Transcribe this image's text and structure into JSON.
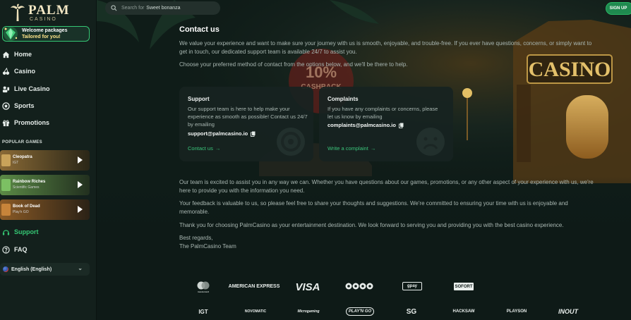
{
  "brand": {
    "name": "PALM",
    "sub": "CASINO"
  },
  "topbar": {
    "search_placeholder": "Search for",
    "search_query": "Sweet bonanza",
    "signup_label": "SIGN UP"
  },
  "welcome": {
    "line1": "Welcome packages",
    "line2": "Tailored for you!"
  },
  "nav": [
    {
      "label": "Home",
      "icon": "home-icon"
    },
    {
      "label": "Casino",
      "icon": "cherries-icon"
    },
    {
      "label": "Live Casino",
      "icon": "live-dealer-icon"
    },
    {
      "label": "Sports",
      "icon": "ball-icon"
    },
    {
      "label": "Promotions",
      "icon": "gift-icon"
    }
  ],
  "popular_games": {
    "title": "POPULAR GAMES",
    "items": [
      {
        "name": "Cleopatra",
        "provider": "IGT",
        "color": "#6f5a33"
      },
      {
        "name": "Rainbow Riches",
        "provider": "Scientific Games",
        "color": "#4d6d3a"
      },
      {
        "name": "Book of Dead",
        "provider": "Play'n GO",
        "color": "#6b4a24"
      }
    ]
  },
  "footer_nav": [
    {
      "label": "Support",
      "icon": "headset-icon",
      "active": true
    },
    {
      "label": "FAQ",
      "icon": "question-icon",
      "active": false
    }
  ],
  "language": {
    "label": "English (English)"
  },
  "contact": {
    "title": "Contact us",
    "intro1": "We value your experience and want to make sure your journey with us is smooth, enjoyable, and trouble-free. If you ever have questions, concerns, or simply want to get in touch, our dedicated support team is available 24/7 to assist you.",
    "intro2": "Choose your preferred method of contact from the options below, and we'll be there to help.",
    "cards": [
      {
        "title": "Support",
        "body": "Our support team is here to help make your experience as smooth as possible! Contact us 24/7 by emailing",
        "email": "support@palmcasino.io",
        "link": "Contact us",
        "arrow": "→"
      },
      {
        "title": "Complaints",
        "body": "If you have any complaints or concerns, please let us know by emailing",
        "email": "complaints@palmcasino.io",
        "link": "Write a complaint",
        "arrow": "→"
      }
    ],
    "outro": [
      "Our team is excited to assist you in any way we can. Whether you have questions about our games, promotions, or any other aspect of your experience with us, we're here to provide you with the information you need.",
      "Your feedback is valuable to us, so please feel free to share your thoughts and suggestions. We're committed to ensuring your time with us is enjoyable and memorable.",
      "Thank you for choosing PalmCasino as your entertainment destination. We look forward to serving you and providing you with the best casino experience."
    ],
    "regards": "Best regards,",
    "team": "The PalmCasino Team"
  },
  "payment_logos": [
    "mastercard",
    "AMERICAN EXPRESS",
    "VISA",
    "",
    "gpay",
    "SOFORT"
  ],
  "provider_logos": [
    "IGT",
    "NOVOMATIC",
    "Microgaming",
    "PLAY'N GO",
    "SG",
    "HACKSAW",
    "PLAYSON",
    "INOUT"
  ],
  "colors": {
    "accent": "#35c774",
    "background": "#0e1a17",
    "sidebar": "#13201c"
  }
}
